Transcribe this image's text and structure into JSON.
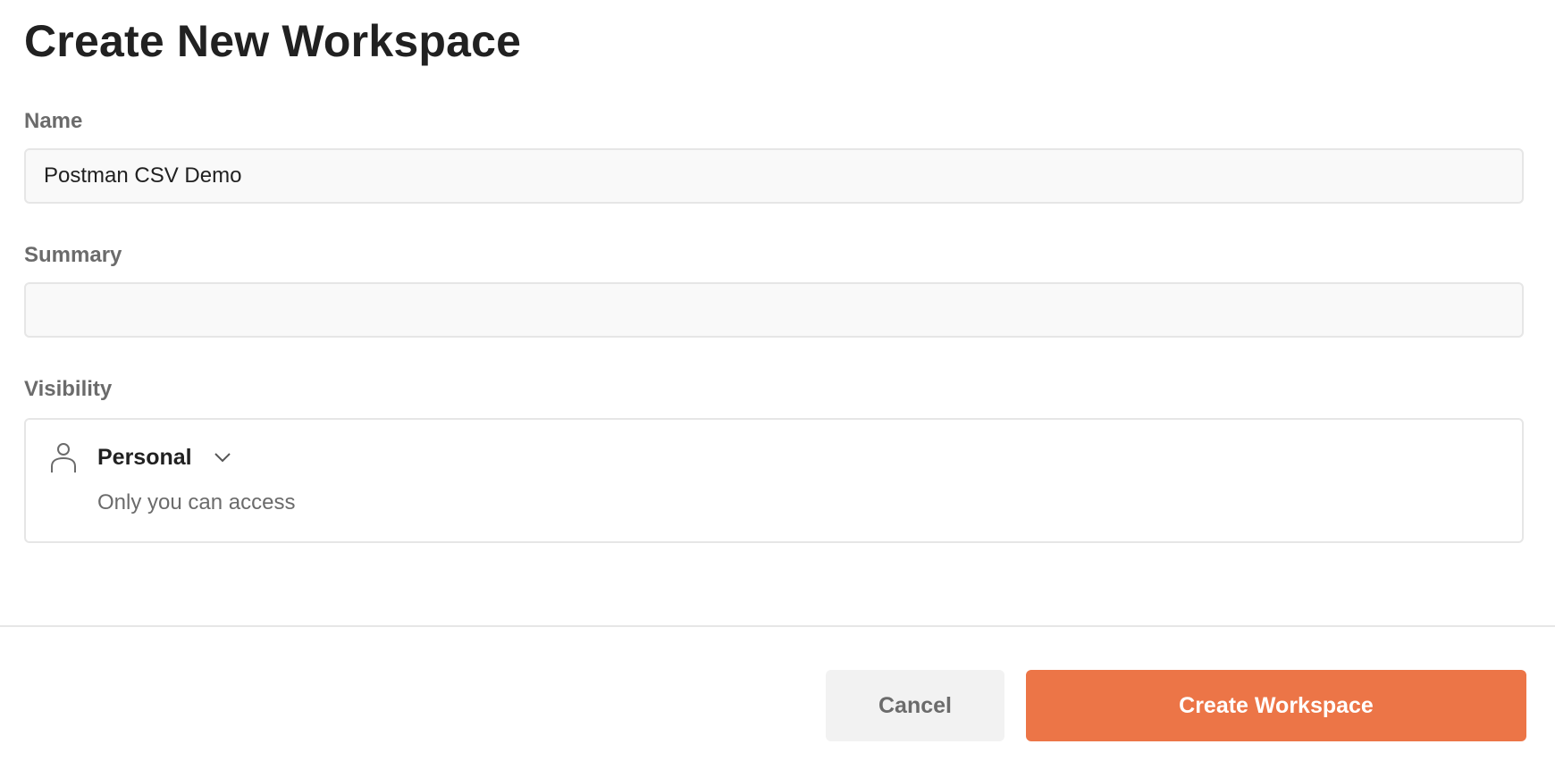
{
  "dialog": {
    "title": "Create New Workspace"
  },
  "form": {
    "name": {
      "label": "Name",
      "value": "Postman CSV Demo",
      "placeholder": ""
    },
    "summary": {
      "label": "Summary",
      "value": "",
      "placeholder": ""
    },
    "visibility": {
      "label": "Visibility",
      "selected": "Personal",
      "description": "Only you can access",
      "icon": "person-icon"
    }
  },
  "footer": {
    "cancel_label": "Cancel",
    "create_label": "Create Workspace"
  },
  "colors": {
    "accent": "#ec7547",
    "label_text": "#6b6b6b",
    "input_bg": "#f9f9f9",
    "border": "#e6e6e6"
  }
}
